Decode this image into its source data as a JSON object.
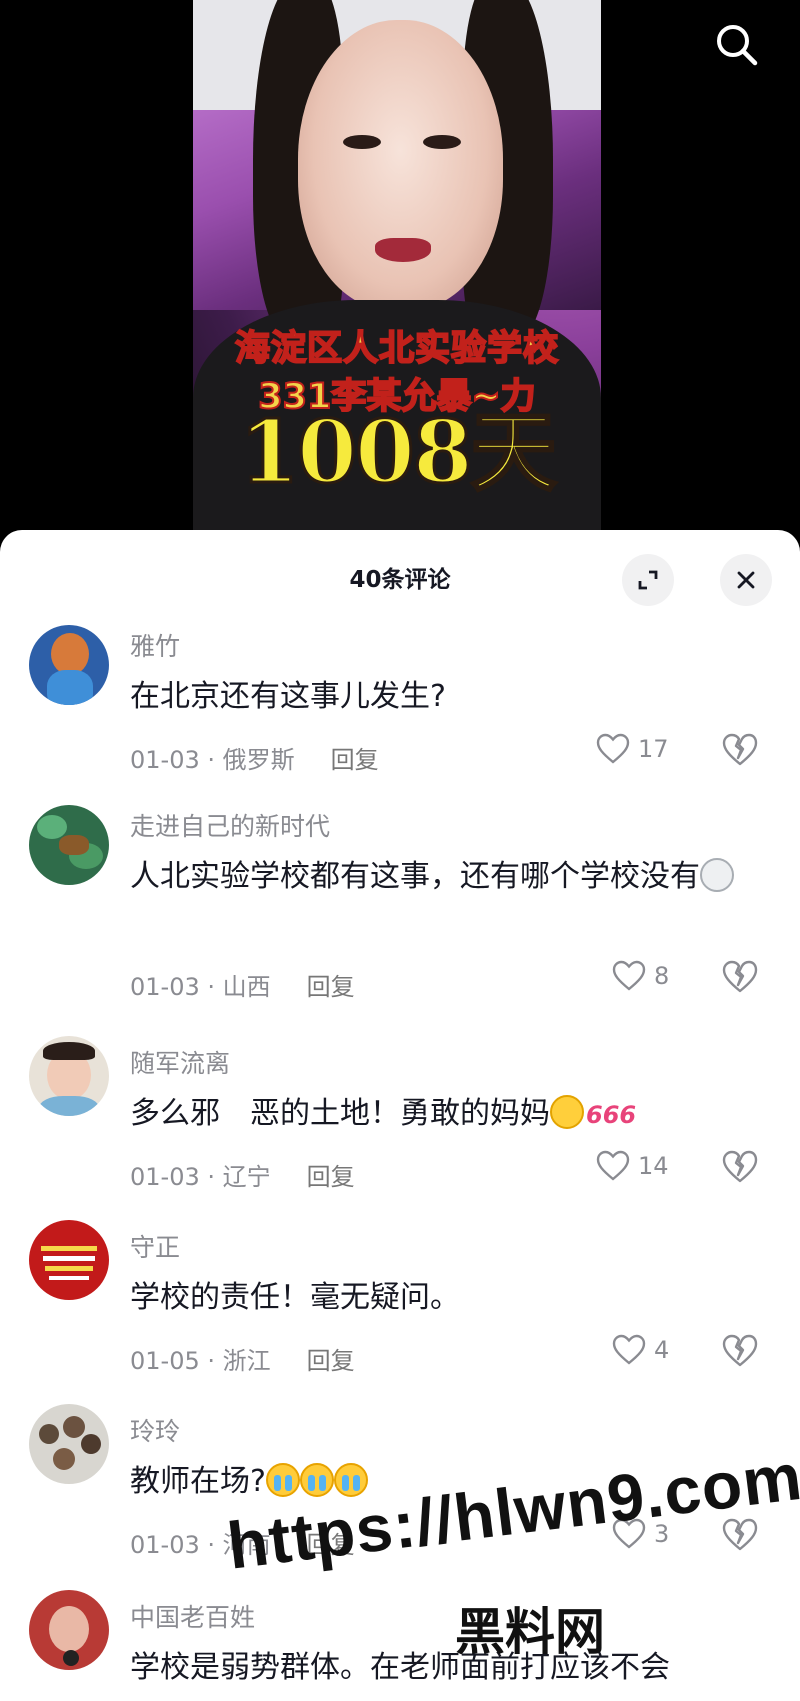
{
  "video": {
    "overlay_line1": "海淀区人北实验学校",
    "overlay_line2": "331李某允暴~力",
    "overlay_line3": "1008天",
    "search_icon": "search-icon"
  },
  "comments_panel": {
    "title": "40条评论",
    "expand_icon": "expand-icon",
    "close_icon": "close-icon"
  },
  "reply_label": "回复",
  "comments": [
    {
      "name": "雅竹",
      "text": "在北京还有这事儿发生?",
      "meta": "01-03 · 俄罗斯",
      "likes": "17"
    },
    {
      "name": "走进自己的新时代",
      "text": "人北实验学校都有这事，还有哪个学校没有",
      "meta": "01-03 · 山西",
      "likes": "8"
    },
    {
      "name": "随军流离",
      "text": "多么邪　恶的土地！勇敢的妈妈",
      "emoji_tag": "666",
      "meta": "01-03 · 辽宁",
      "likes": "14"
    },
    {
      "name": "守正",
      "text": "学校的责任！毫无疑问。",
      "meta": "01-05 · 浙江",
      "likes": "4"
    },
    {
      "name": "玲玲",
      "text": "教师在场?",
      "meta": "01-03 · 河南",
      "likes": "3"
    },
    {
      "name": "中国老百姓",
      "text": "学校是弱势群体。在老师面前打应该不会"
    }
  ],
  "watermark": {
    "line1": "https://hlwn9.com",
    "line2": "黑料网"
  }
}
